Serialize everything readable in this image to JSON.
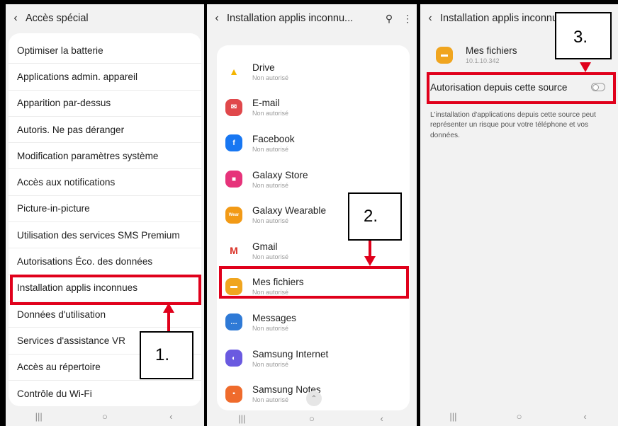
{
  "panel1": {
    "title": "Accès spécial",
    "items": [
      "Optimiser la batterie",
      "Applications admin. appareil",
      "Apparition par-dessus",
      "Autoris. Ne pas déranger",
      "Modification paramètres système",
      "Accès aux notifications",
      "Picture-in-picture",
      "Utilisation des services SMS Premium",
      "Autorisations Éco. des données",
      "Installation applis inconnues",
      "Données d'utilisation",
      "Services d'assistance VR",
      "Accès au répertoire",
      "Contrôle du Wi-Fi"
    ],
    "step_label": "1."
  },
  "panel2": {
    "title": "Installation applis inconnu...",
    "apps": [
      {
        "name": "Drive",
        "status": "Non autorisé",
        "color": "#ffffff",
        "glyph": "▲"
      },
      {
        "name": "E-mail",
        "status": "Non autorisé",
        "color": "#e0484b",
        "glyph": "✉"
      },
      {
        "name": "Facebook",
        "status": "Non autorisé",
        "color": "#1877f2",
        "glyph": "f"
      },
      {
        "name": "Galaxy Store",
        "status": "Non autorisé",
        "color": "#e6337a",
        "glyph": "■"
      },
      {
        "name": "Galaxy Wearable",
        "status": "Non autorisé",
        "color": "#f29a16",
        "glyph": "Wear"
      },
      {
        "name": "Gmail",
        "status": "Non autorisé",
        "color": "#ffffff",
        "glyph": "M"
      },
      {
        "name": "Mes fichiers",
        "status": "Non autorisé",
        "color": "#f0a51f",
        "glyph": "▬"
      },
      {
        "name": "Messages",
        "status": "Non autorisé",
        "color": "#2f7ad6",
        "glyph": "…"
      },
      {
        "name": "Samsung Internet",
        "status": "Non autorisé",
        "color": "#6a5ae0",
        "glyph": "◐"
      },
      {
        "name": "Samsung Notes",
        "status": "Non autorisé",
        "color": "#ef6b2c",
        "glyph": "▪"
      }
    ],
    "step_label": "2."
  },
  "panel3": {
    "title": "Installation applis inconnues",
    "app_name": "Mes fichiers",
    "app_version": "10.1.10.342",
    "toggle_label": "Autorisation depuis cette source",
    "warning": "L'installation d'applications depuis cette source peut représenter un risque pour votre téléphone et vos données.",
    "step_label": "3."
  },
  "colors": {
    "highlight": "#e0001b"
  }
}
